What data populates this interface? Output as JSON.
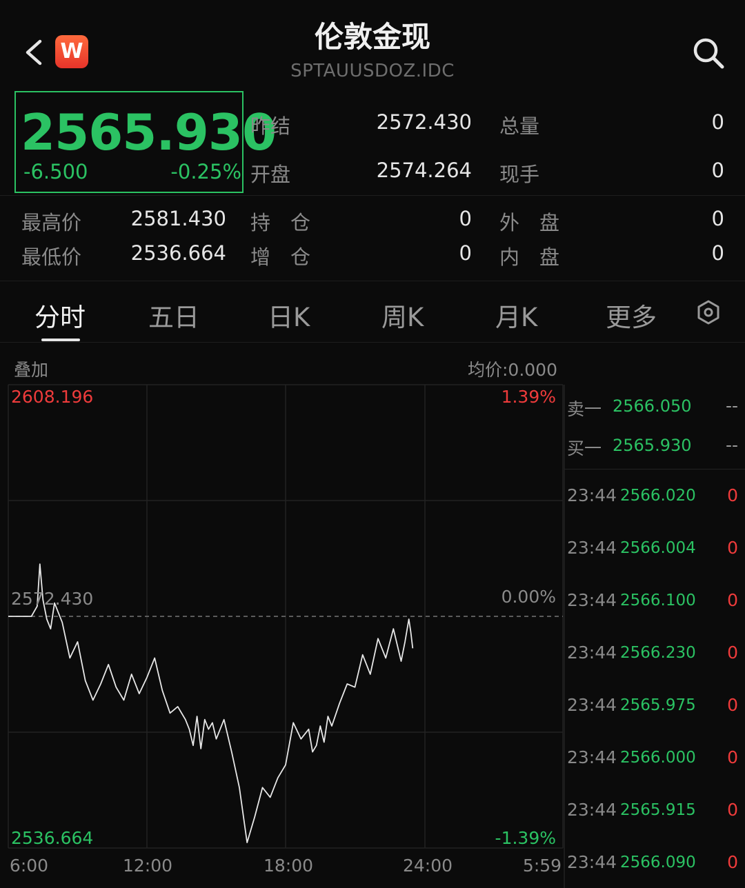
{
  "header": {
    "title": "伦敦金现",
    "subtitle": "SPTAUUSDOZ.IDC",
    "logo_text": "W"
  },
  "quote": {
    "price": "2565.930",
    "change": "-6.500",
    "change_pct": "-0.25%"
  },
  "stats": {
    "prev_settle_label": "昨结",
    "prev_settle": "2572.430",
    "volume_label": "总量",
    "volume": "0",
    "open_label": "开盘",
    "open": "2574.264",
    "current_hand_label": "现手",
    "current_hand": "0",
    "high_label": "最高价",
    "high": "2581.430",
    "position_label": "持　仓",
    "position": "0",
    "outer_label": "外　盘",
    "outer": "0",
    "low_label": "最低价",
    "low": "2536.664",
    "add_position_label": "增　仓",
    "add_position": "0",
    "inner_label": "内　盘",
    "inner": "0"
  },
  "tabs": [
    {
      "label": "分时",
      "active": true
    },
    {
      "label": "五日"
    },
    {
      "label": "日K"
    },
    {
      "label": "周K"
    },
    {
      "label": "月K"
    },
    {
      "label": "更多"
    }
  ],
  "chart_bar": {
    "overlay_label": "叠加",
    "avg_price_label": "均价:0.000"
  },
  "chart_data": {
    "type": "line",
    "y_top_label": "2608.196",
    "y_mid_label": "2572.430",
    "y_bottom_label": "2536.664",
    "pct_top_label": "1.39%",
    "pct_mid_label": "0.00%",
    "pct_bottom_label": "-1.39%",
    "x_tick_labels": [
      "6:00",
      "12:00",
      "18:00",
      "24:00",
      "5:59"
    ],
    "ylim": [
      2536.664,
      2608.196
    ],
    "baseline": 2572.43,
    "xlim": [
      0,
      1440
    ],
    "grid": true,
    "series": [
      {
        "x": [
          0,
          60,
          75,
          82,
          90,
          100,
          110,
          120,
          140,
          160,
          180,
          200,
          220,
          240,
          260,
          280,
          300,
          320,
          340,
          360,
          380,
          400,
          420,
          440,
          460,
          470,
          480,
          490,
          500,
          510,
          520,
          530,
          540,
          560,
          580,
          600,
          620,
          640,
          660,
          680,
          700,
          720,
          740,
          760,
          780,
          790,
          800,
          810,
          820,
          830,
          840,
          860,
          880,
          900,
          920,
          940,
          960,
          980,
          1000,
          1020,
          1030,
          1040,
          1045,
          1050
        ],
        "y": [
          2572.43,
          2572.43,
          2574.0,
          2580.5,
          2575.0,
          2572.0,
          2570.5,
          2574.5,
          2571.5,
          2566.0,
          2568.5,
          2562.5,
          2559.5,
          2562.0,
          2565.0,
          2561.5,
          2559.5,
          2563.5,
          2560.5,
          2563.0,
          2566.0,
          2561.0,
          2557.5,
          2558.5,
          2556.5,
          2555.0,
          2552.5,
          2557.0,
          2552.0,
          2556.5,
          2555.0,
          2556.0,
          2553.5,
          2556.5,
          2551.5,
          2546.0,
          2537.5,
          2541.5,
          2546.0,
          2544.5,
          2547.5,
          2549.5,
          2556.0,
          2553.5,
          2555.0,
          2551.5,
          2552.5,
          2555.5,
          2553.0,
          2557.0,
          2555.5,
          2559.0,
          2562.0,
          2561.5,
          2566.5,
          2563.5,
          2569.0,
          2566.0,
          2570.5,
          2565.5,
          2568.5,
          2572.0,
          2570.0,
          2567.5
        ]
      }
    ]
  },
  "order_book": {
    "ask_label": "卖一",
    "ask_price": "2566.050",
    "ask_vol": "--",
    "bid_label": "买一",
    "bid_price": "2565.930",
    "bid_vol": "--",
    "ticks": [
      {
        "time": "23:44",
        "price": "2566.020",
        "vol": "0"
      },
      {
        "time": "23:44",
        "price": "2566.004",
        "vol": "0"
      },
      {
        "time": "23:44",
        "price": "2566.100",
        "vol": "0"
      },
      {
        "time": "23:44",
        "price": "2566.230",
        "vol": "0"
      },
      {
        "time": "23:44",
        "price": "2565.975",
        "vol": "0"
      },
      {
        "time": "23:44",
        "price": "2566.000",
        "vol": "0"
      },
      {
        "time": "23:44",
        "price": "2565.915",
        "vol": "0"
      },
      {
        "time": "23:44",
        "price": "2566.090",
        "vol": "0"
      }
    ]
  },
  "colors": {
    "up": "#ee3b3b",
    "down": "#2bc263",
    "line": "#e8e8e8",
    "grid": "#232323"
  },
  "icons": {
    "back": "chevron-left-icon",
    "search": "search-icon",
    "settings": "hexagon-settings-icon"
  }
}
